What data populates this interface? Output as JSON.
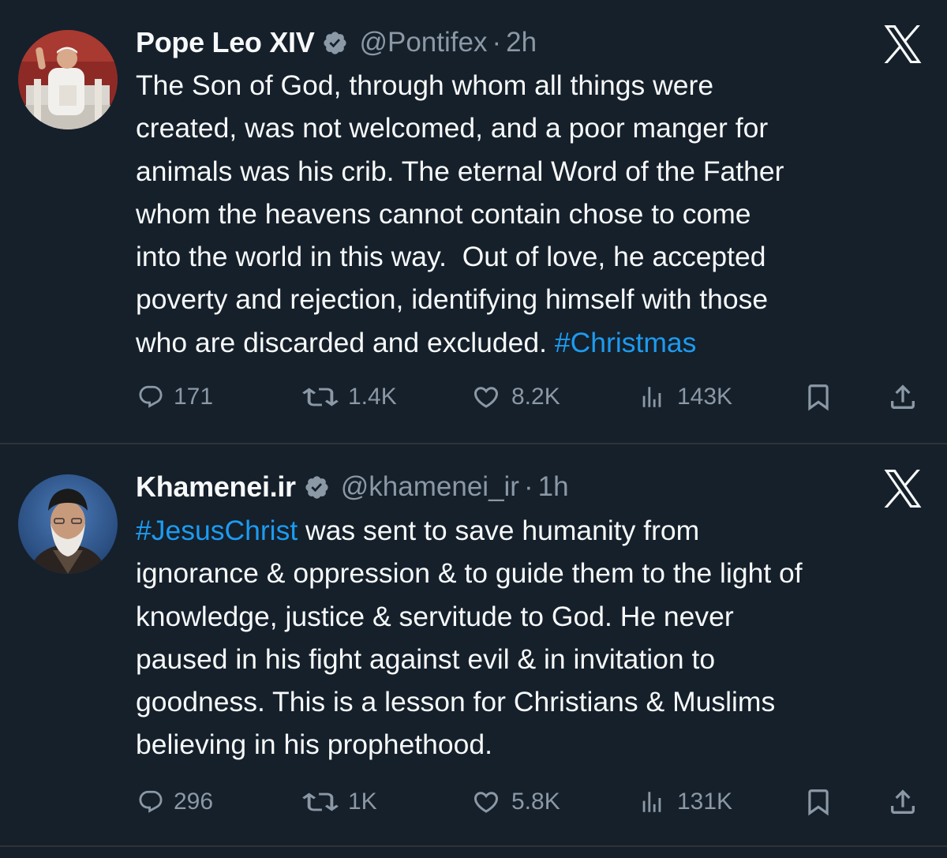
{
  "tweets": [
    {
      "display_name": "Pope Leo XIV",
      "handle": "@Pontifex",
      "separator": "·",
      "time": "2h",
      "text_lines": [
        "The Son of God, through whom all things were",
        "created, was not welcomed, and a poor manger for",
        "animals was his crib. The eternal Word of the Father",
        "whom the heavens cannot contain chose to come",
        "into the world in this way.  Out of love, he accepted",
        "poverty and rejection, identifying himself with those",
        "who are discarded and excluded. "
      ],
      "hashtag": "#Christmas",
      "replies": "171",
      "reposts": "1.4K",
      "likes": "8.2K",
      "views": "143K"
    },
    {
      "display_name": "Khamenei.ir",
      "handle": "@khamenei_ir",
      "separator": "·",
      "time": "1h",
      "hashtag": "#JesusChrist",
      "text_lines": [
        " was sent to save humanity from",
        "ignorance & oppression & to guide them to the light of",
        "knowledge, justice & servitude to God. He never",
        "paused in his fight against evil & in invitation to",
        "goodness. This is a lesson for Christians & Muslims",
        "believing in his prophethood."
      ],
      "replies": "296",
      "reposts": "1K",
      "likes": "5.8K",
      "views": "131K"
    }
  ],
  "colors": {
    "background": "#15202b",
    "text": "#f7f9f9",
    "secondary_text": "#8b98a5",
    "hashtag": "#1d9bf0",
    "divider": "#2f3336"
  },
  "icons": [
    "verified-badge-icon",
    "x-logo-icon",
    "reply-icon",
    "repost-icon",
    "like-icon",
    "views-icon",
    "bookmark-icon",
    "share-icon"
  ]
}
